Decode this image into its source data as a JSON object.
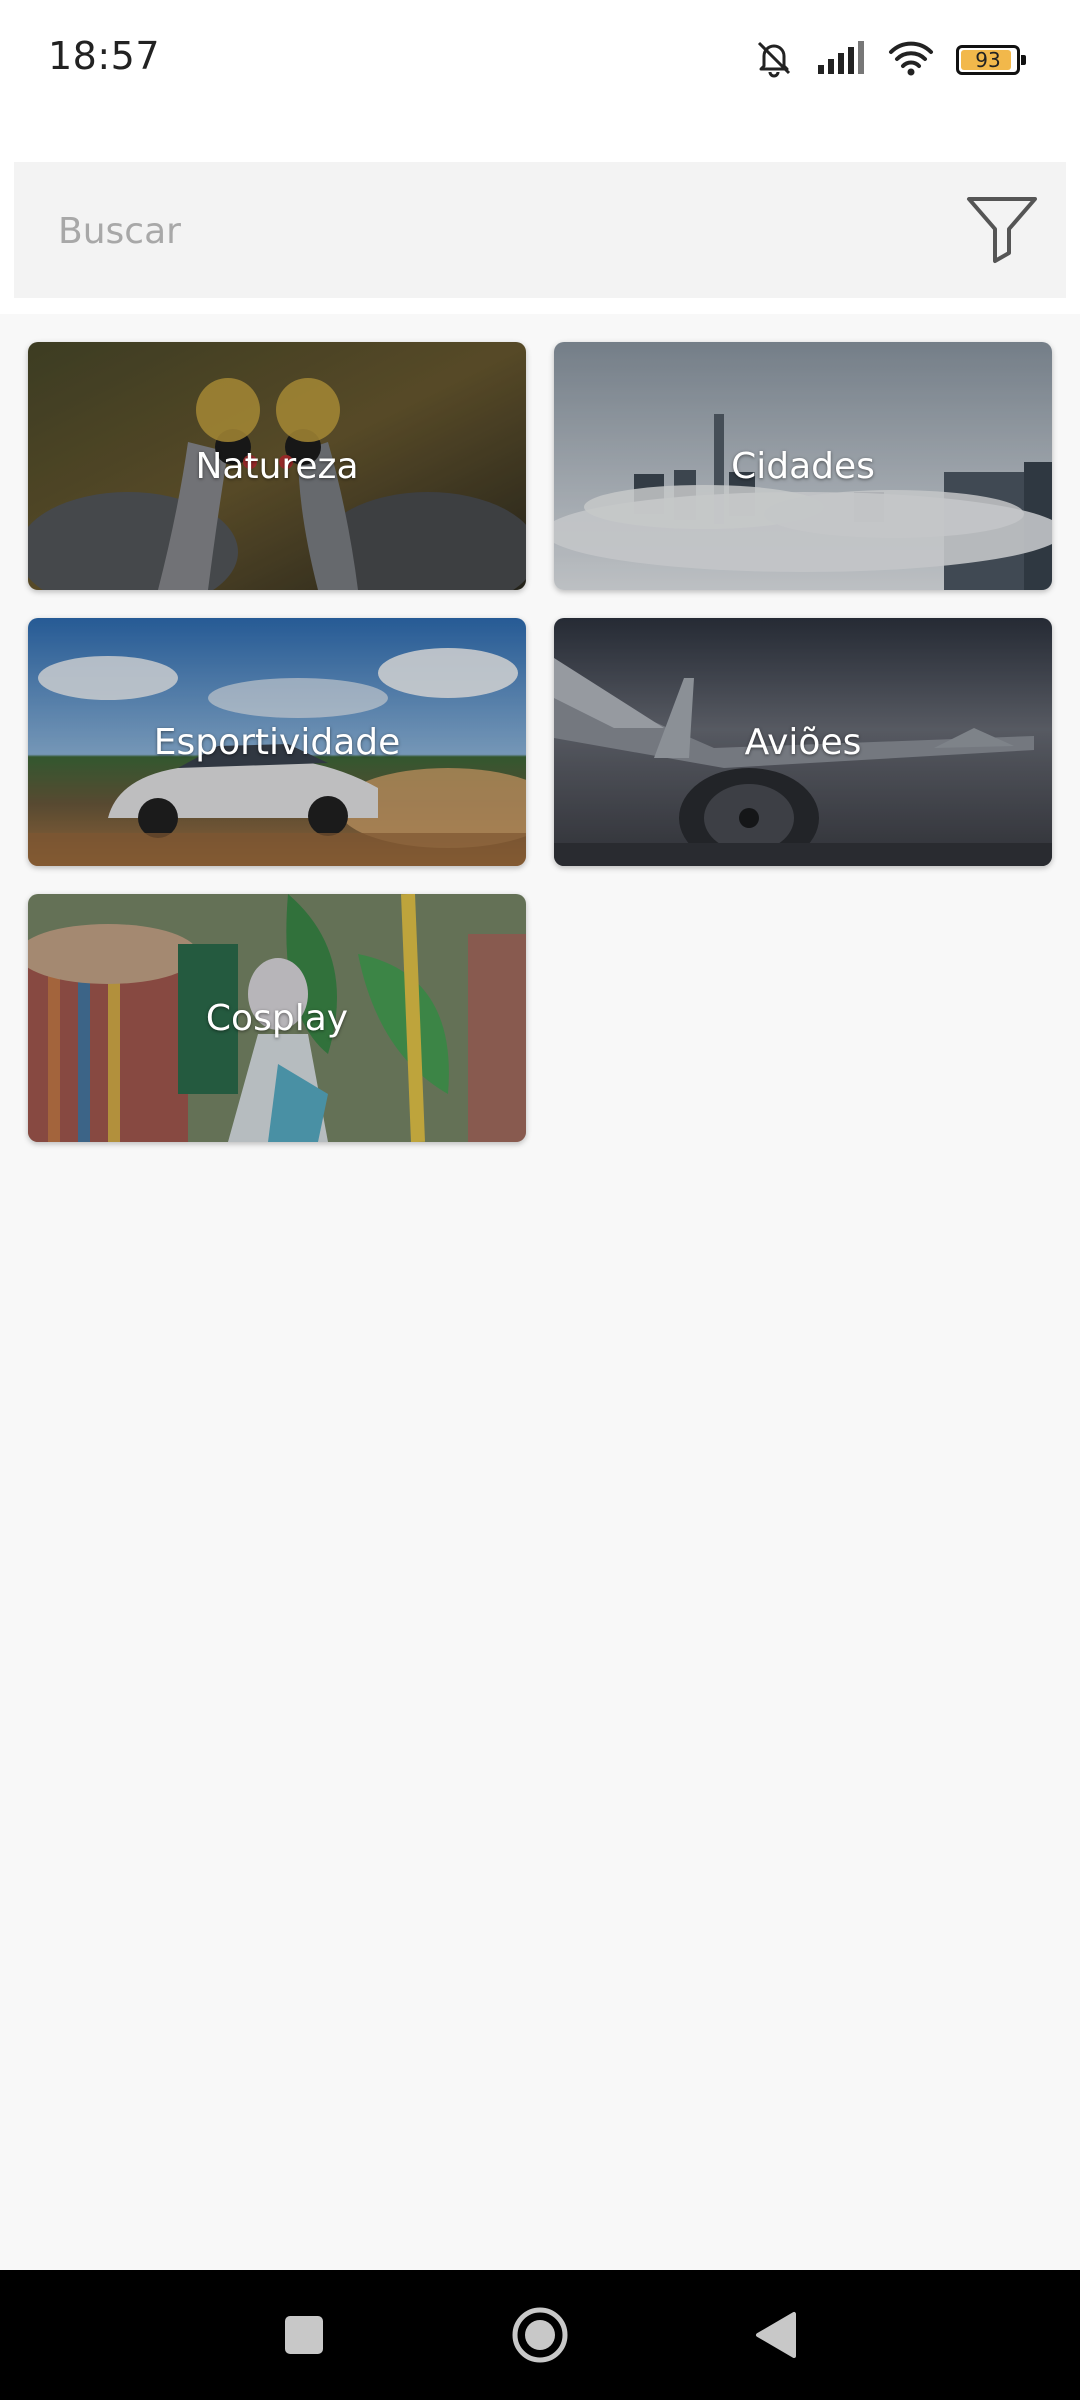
{
  "status": {
    "time": "18:57",
    "battery": "93",
    "battery_level": 0.93,
    "icons": [
      "bell-muted-icon",
      "signal-icon",
      "wifi-icon",
      "battery-icon"
    ]
  },
  "search": {
    "placeholder": "Buscar",
    "value": "",
    "filter_icon": "filter-icon"
  },
  "categories": [
    {
      "label": "Natureza"
    },
    {
      "label": "Cidades"
    },
    {
      "label": "Esportividade"
    },
    {
      "label": "Aviões"
    },
    {
      "label": "Cosplay"
    }
  ],
  "navbar": {
    "icons": [
      "recents-square-icon",
      "home-circle-icon",
      "back-triangle-icon"
    ]
  },
  "colors": {
    "background": "#f8f8f8",
    "search_bg": "#f3f3f3",
    "battery_fill": "#f2b84b"
  }
}
